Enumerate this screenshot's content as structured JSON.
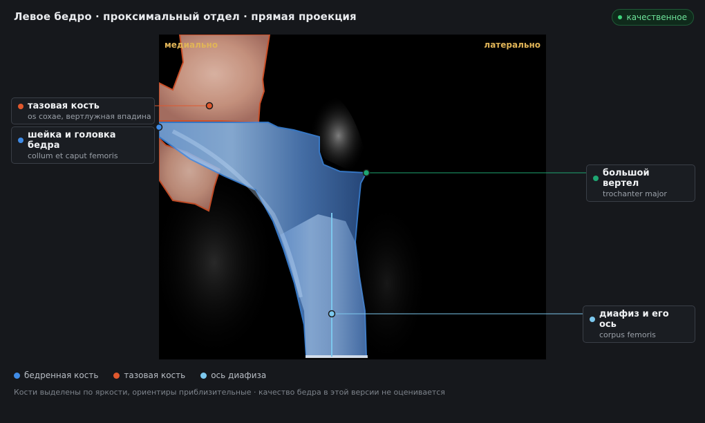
{
  "header": {
    "title": "Левое бедро · проксимальный отдел · прямая проекция",
    "quality_badge": "качественное"
  },
  "viewer": {
    "orientation_left": "медиально",
    "orientation_right": "латерально"
  },
  "callouts": {
    "pelvis": {
      "name": "тазовая кость",
      "latin": "os coxae, вертлужная впадина",
      "color": "#e0582d"
    },
    "neck_head": {
      "name": "шейка и головка бедра",
      "latin": "collum et caput femoris",
      "color": "#3f8be6"
    },
    "trochanter": {
      "name": "большой вертел",
      "latin": "trochanter major",
      "color": "#1ea672"
    },
    "shaft": {
      "name": "диафиз и его ось",
      "latin": "corpus femoris",
      "color": "#7cc8ee"
    }
  },
  "legend": {
    "femur": {
      "label": "бедренная кость",
      "color": "#3f8be6"
    },
    "pelvis": {
      "label": "тазовая кость",
      "color": "#e0582d"
    },
    "axis": {
      "label": "ось диафиза",
      "color": "#7cc8ee"
    }
  },
  "footnote": "Кости выделены по яркости, ориентиры приблизительные · качество бедра в этой версии не оценивается"
}
